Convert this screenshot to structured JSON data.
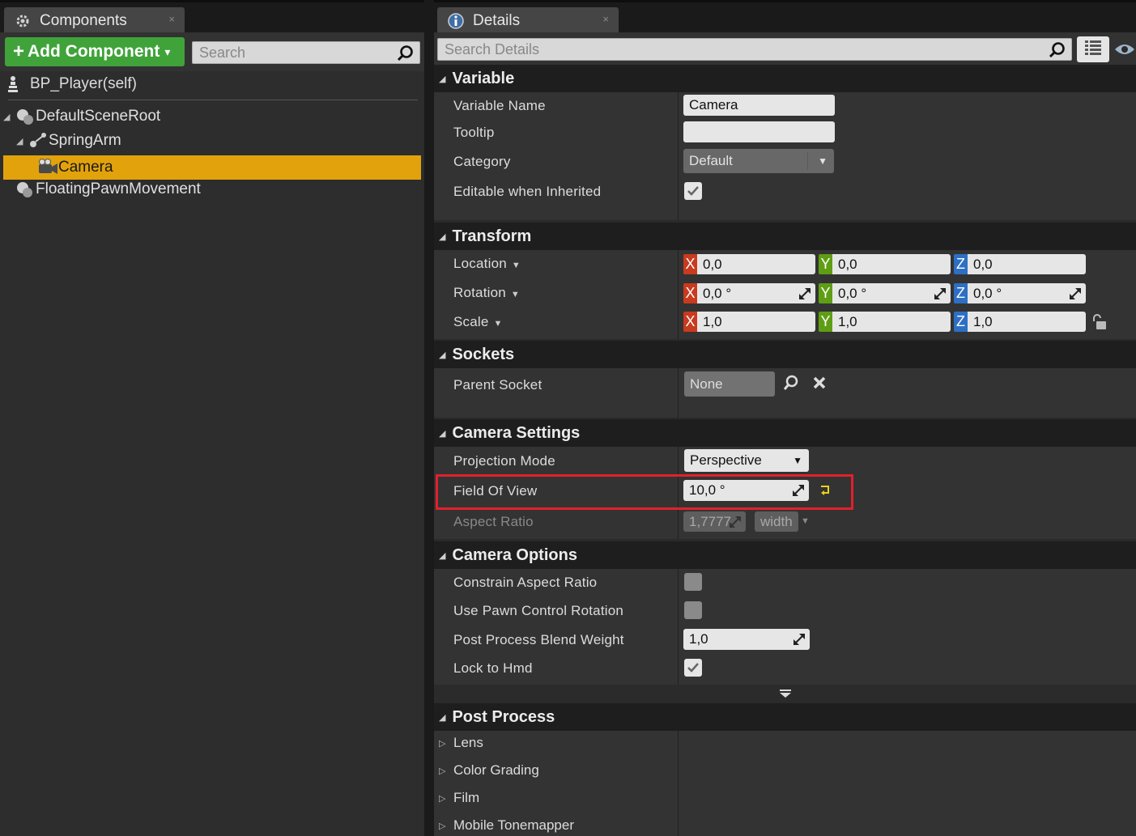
{
  "components_tab": {
    "title": "Components",
    "close": "×"
  },
  "details_tab": {
    "title": "Details",
    "close": "×"
  },
  "add_component": {
    "label": "Add Component",
    "plus": "+",
    "caret": "▾"
  },
  "component_search": {
    "placeholder": "Search"
  },
  "self_item": "BP_Player(self)",
  "tree": [
    {
      "label": "DefaultSceneRoot",
      "expanded": true
    },
    {
      "label": "SpringArm",
      "expanded": true
    },
    {
      "label": "Camera",
      "selected": true
    },
    {
      "label": "FloatingPawnMovement"
    }
  ],
  "details_search": {
    "placeholder": "Search Details"
  },
  "sections": {
    "variable": {
      "title": "Variable",
      "variable_name_label": "Variable Name",
      "variable_name_value": "Camera",
      "tooltip_label": "Tooltip",
      "tooltip_value": "",
      "category_label": "Category",
      "category_value": "Default",
      "editable_label": "Editable when Inherited",
      "editable_checked": true
    },
    "transform": {
      "title": "Transform",
      "location_label": "Location",
      "rotation_label": "Rotation",
      "scale_label": "Scale",
      "axis_x": "X",
      "axis_y": "Y",
      "axis_z": "Z",
      "location": [
        "0,0",
        "0,0",
        "0,0"
      ],
      "rotation": [
        "0,0 °",
        "0,0 °",
        "0,0 °"
      ],
      "scale": [
        "1,0",
        "1,0",
        "1,0"
      ]
    },
    "sockets": {
      "title": "Sockets",
      "parent_socket_label": "Parent Socket",
      "parent_socket_value": "None"
    },
    "camera_settings": {
      "title": "Camera Settings",
      "projection_mode_label": "Projection Mode",
      "projection_mode_value": "Perspective",
      "fov_label": "Field Of View",
      "fov_value": "10,0 °",
      "aspect_ratio_label": "Aspect Ratio",
      "aspect_ratio_value": "1,7777",
      "aspect_axis_value": "width"
    },
    "camera_options": {
      "title": "Camera Options",
      "constrain_label": "Constrain Aspect Ratio",
      "constrain_checked": false,
      "pawn_rot_label": "Use Pawn Control Rotation",
      "pawn_rot_checked": false,
      "blend_weight_label": "Post Process Blend Weight",
      "blend_weight_value": "1,0",
      "lock_hmd_label": "Lock to Hmd",
      "lock_hmd_checked": true
    },
    "post_process": {
      "title": "Post Process",
      "items": [
        "Lens",
        "Color Grading",
        "Film",
        "Mobile Tonemapper"
      ]
    }
  },
  "colors": {
    "selection": "#e2a20c",
    "add_button": "#3fa33a",
    "axis_x": "#c93a1e",
    "axis_y": "#5f9e14",
    "axis_z": "#2d6fc4",
    "highlight": "#e0212c"
  },
  "icons": [
    "gear-icon",
    "info-icon",
    "search-icon",
    "grid-view-icon",
    "eye-icon",
    "pawn-icon",
    "scene-root-icon",
    "spring-arm-icon",
    "camera-icon",
    "movement-icon",
    "reset-arrow-icon",
    "lock-icon",
    "browse-icon",
    "clear-icon",
    "spin-icon"
  ]
}
